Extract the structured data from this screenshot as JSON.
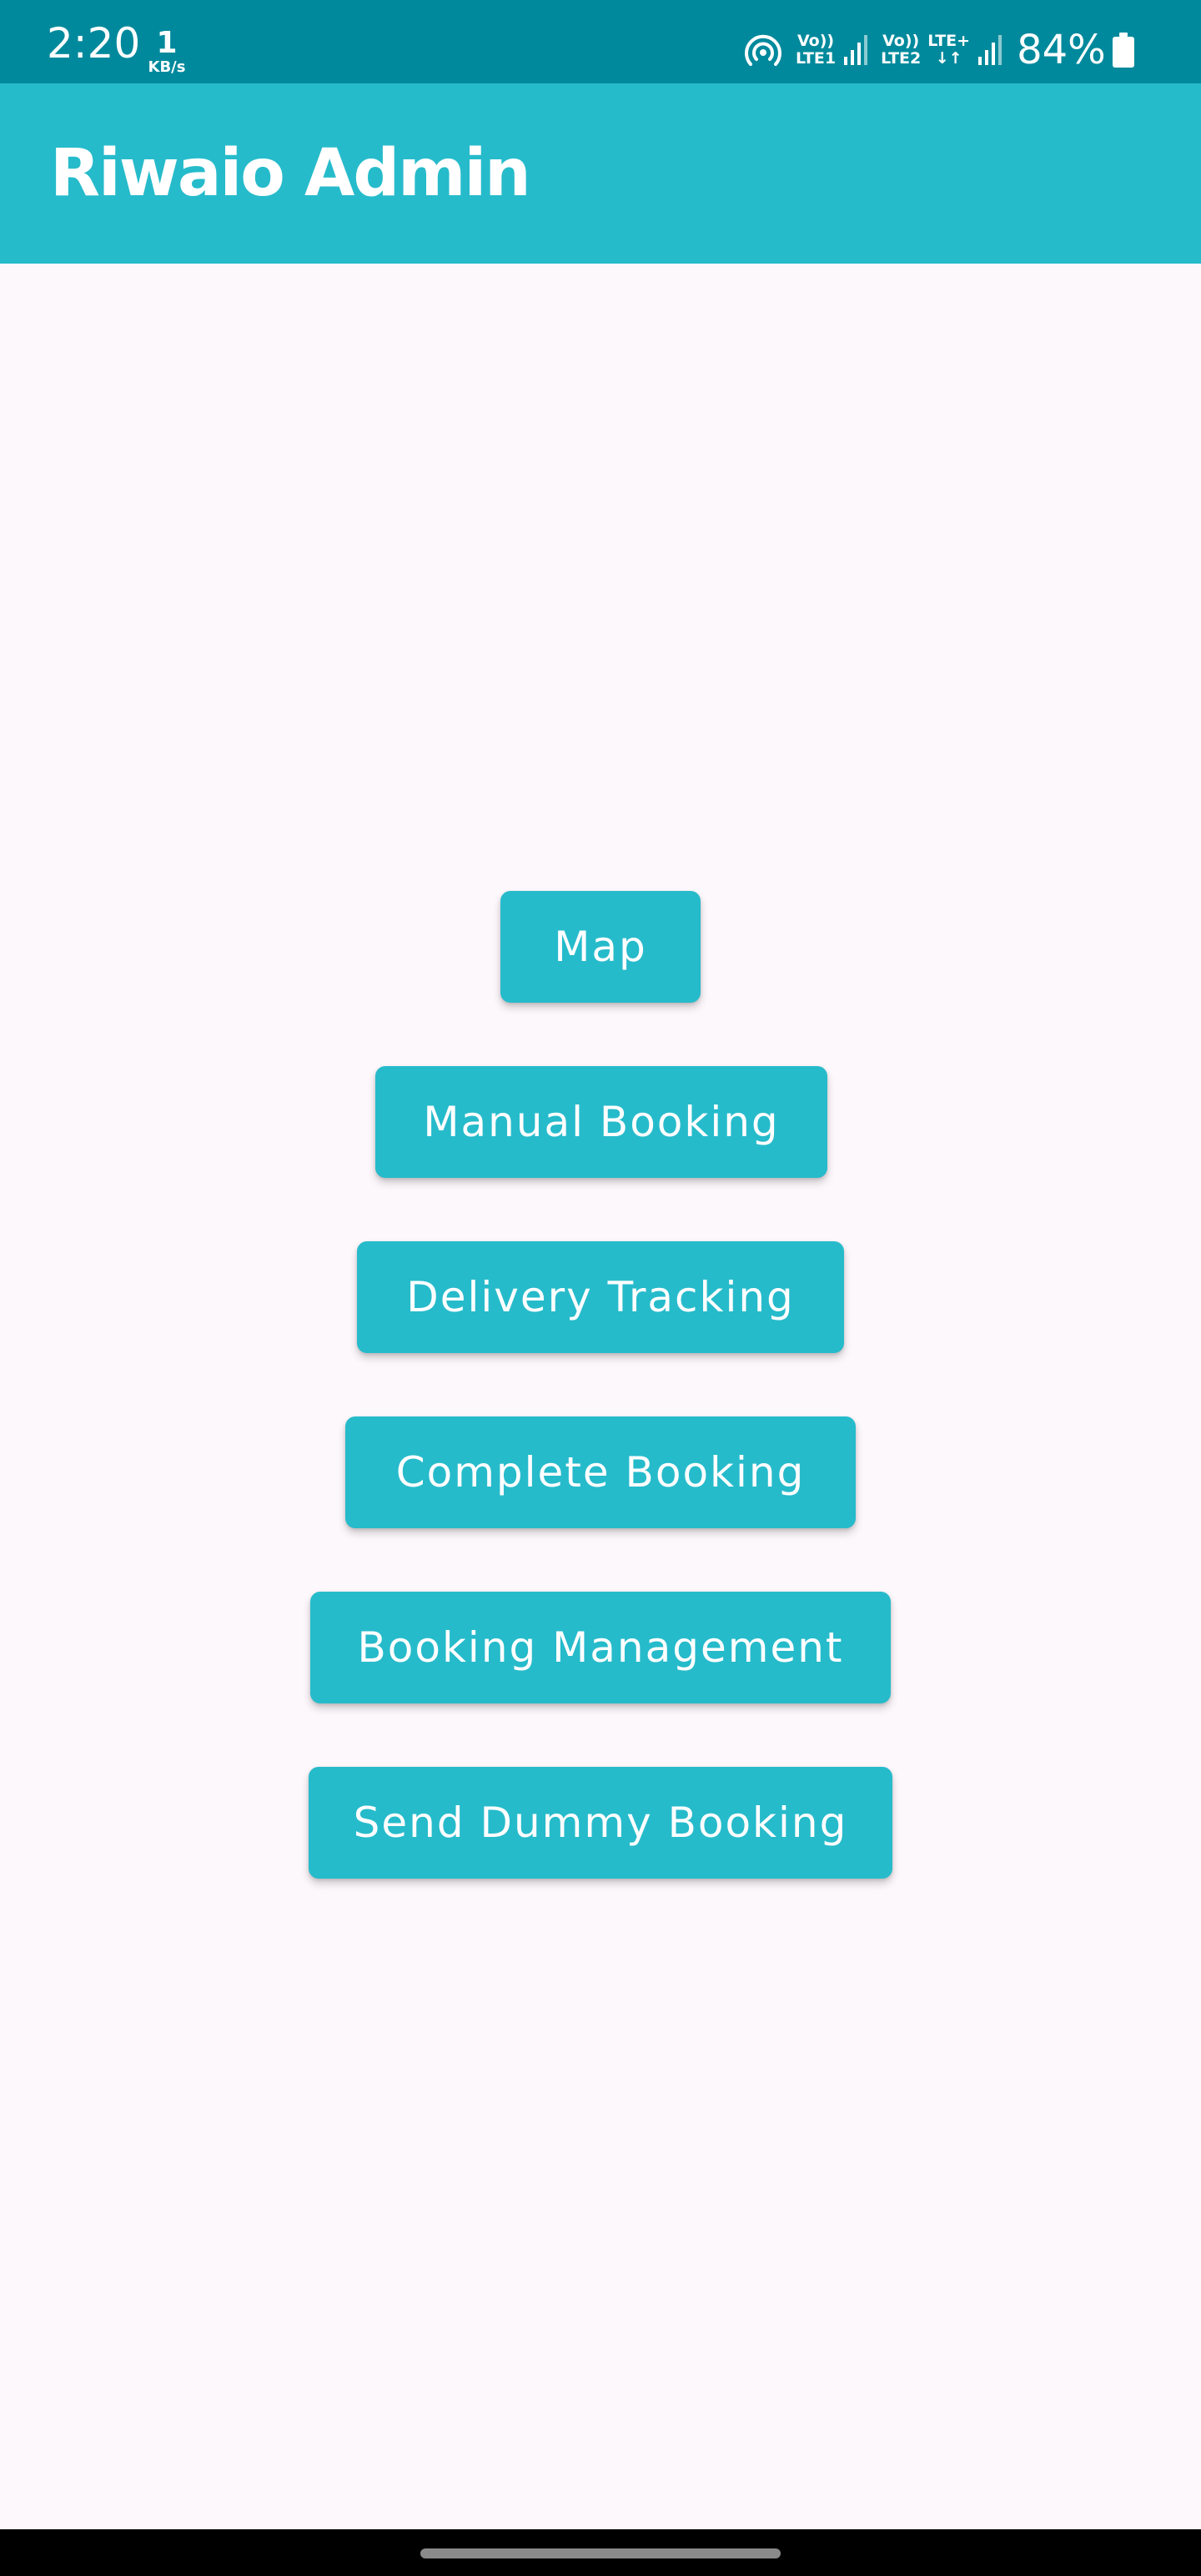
{
  "status_bar": {
    "time": "2:20",
    "net_speed_value": "1",
    "net_speed_unit": "KB/s",
    "sim1": {
      "line1": "Vo))",
      "line2": "LTE1"
    },
    "sim2": {
      "line1": "Vo))",
      "line2": "LTE2"
    },
    "network_type": {
      "line1": "LTE+",
      "line2": "↓↑"
    },
    "battery_percent": "84%",
    "icons": [
      "hotspot-icon",
      "signal-icon",
      "signal-icon",
      "battery-icon"
    ]
  },
  "app_bar": {
    "title": "Riwaio Admin"
  },
  "menu": {
    "buttons": [
      {
        "id": "map",
        "label": "Map"
      },
      {
        "id": "manual_booking",
        "label": "Manual Booking"
      },
      {
        "id": "delivery_tracking",
        "label": "Delivery Tracking"
      },
      {
        "id": "complete_booking",
        "label": "Complete Booking"
      },
      {
        "id": "booking_management",
        "label": "Booking Management"
      },
      {
        "id": "send_dummy_booking",
        "label": "Send Dummy Booking"
      }
    ]
  },
  "colors": {
    "status_bar": "#00899c",
    "primary": "#26bbcb",
    "background": "#fdf8fc",
    "nav_bar": "#000000"
  }
}
